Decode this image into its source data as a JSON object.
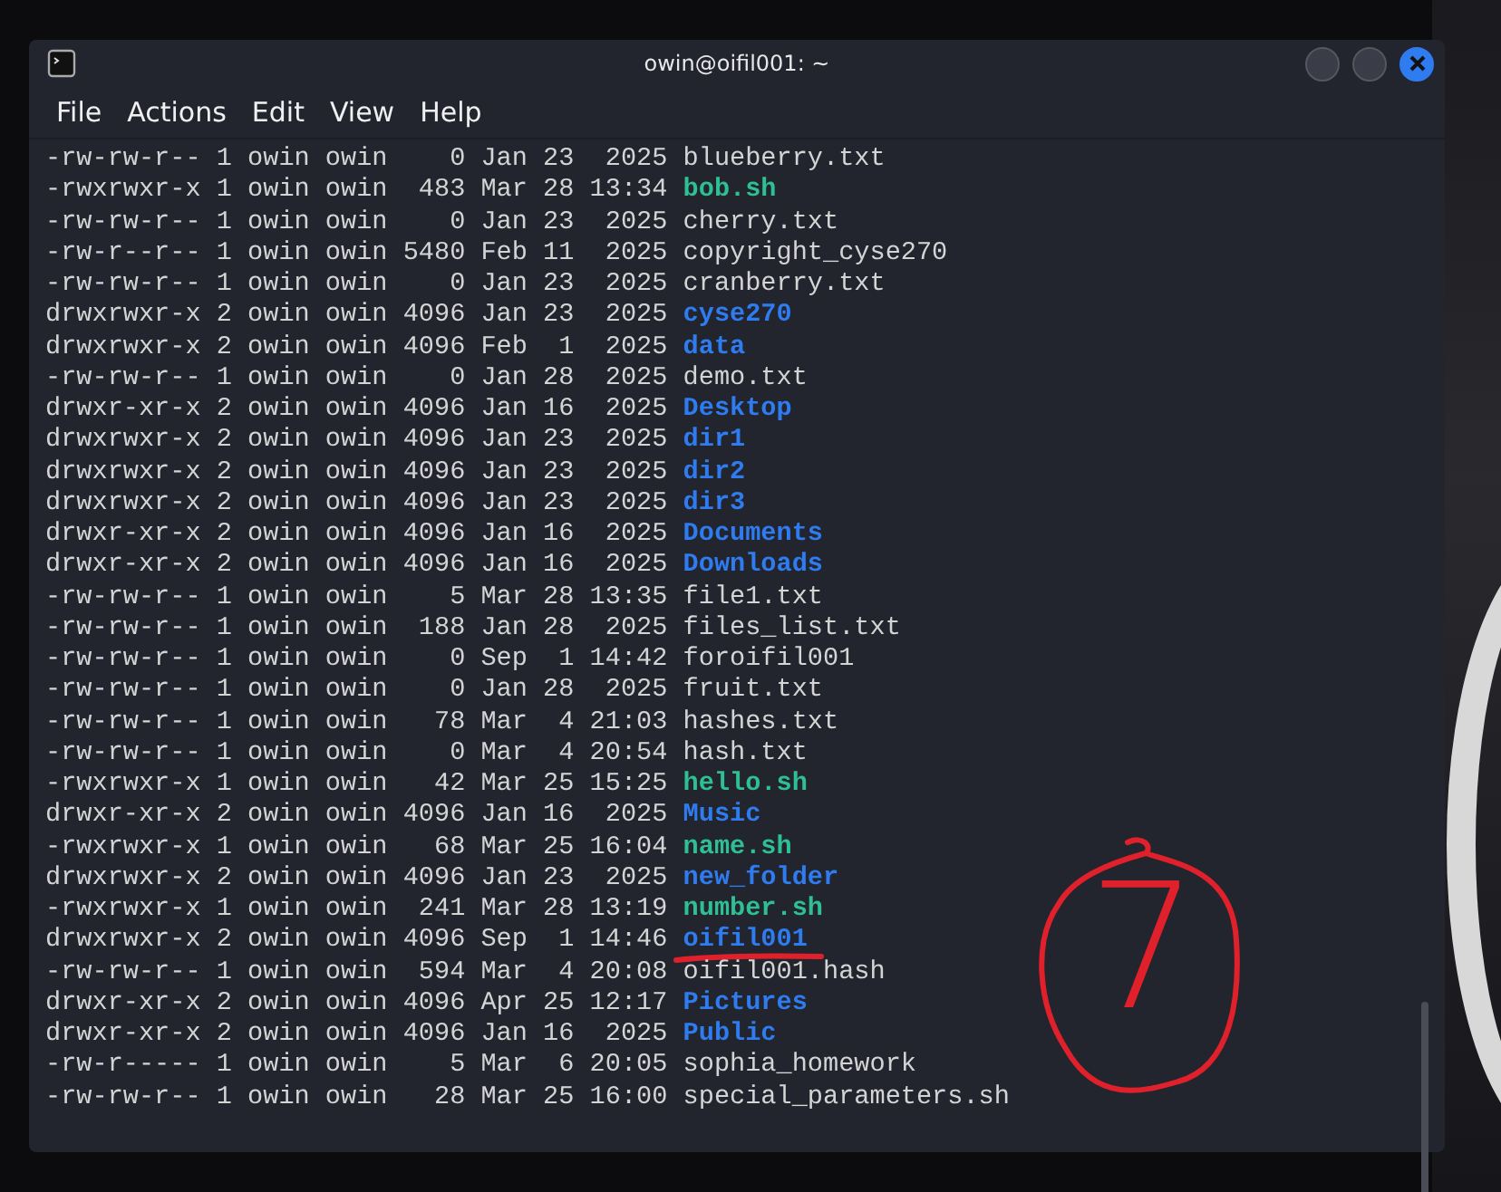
{
  "window": {
    "title": "owin@oifil001: ~"
  },
  "menu": [
    "File",
    "Actions",
    "Edit",
    "View",
    "Help"
  ],
  "listing": [
    {
      "meta": "-rw-rw-r-- 1 owin owin    0 Jan 23  2025",
      "name": "blueberry.txt",
      "kind": "file",
      "underlined": false
    },
    {
      "meta": "-rwxrwxr-x 1 owin owin  483 Mar 28 13:34",
      "name": "bob.sh",
      "kind": "exec",
      "underlined": false
    },
    {
      "meta": "-rw-rw-r-- 1 owin owin    0 Jan 23  2025",
      "name": "cherry.txt",
      "kind": "file",
      "underlined": false
    },
    {
      "meta": "-rw-r--r-- 1 owin owin 5480 Feb 11  2025",
      "name": "copyright_cyse270",
      "kind": "file",
      "underlined": false
    },
    {
      "meta": "-rw-rw-r-- 1 owin owin    0 Jan 23  2025",
      "name": "cranberry.txt",
      "kind": "file",
      "underlined": false
    },
    {
      "meta": "drwxrwxr-x 2 owin owin 4096 Jan 23  2025",
      "name": "cyse270",
      "kind": "dir",
      "underlined": false
    },
    {
      "meta": "drwxrwxr-x 2 owin owin 4096 Feb  1  2025",
      "name": "data",
      "kind": "dir",
      "underlined": false
    },
    {
      "meta": "-rw-rw-r-- 1 owin owin    0 Jan 28  2025",
      "name": "demo.txt",
      "kind": "file",
      "underlined": false
    },
    {
      "meta": "drwxr-xr-x 2 owin owin 4096 Jan 16  2025",
      "name": "Desktop",
      "kind": "dir",
      "underlined": false
    },
    {
      "meta": "drwxrwxr-x 2 owin owin 4096 Jan 23  2025",
      "name": "dir1",
      "kind": "dir",
      "underlined": false
    },
    {
      "meta": "drwxrwxr-x 2 owin owin 4096 Jan 23  2025",
      "name": "dir2",
      "kind": "dir",
      "underlined": false
    },
    {
      "meta": "drwxrwxr-x 2 owin owin 4096 Jan 23  2025",
      "name": "dir3",
      "kind": "dir",
      "underlined": false
    },
    {
      "meta": "drwxr-xr-x 2 owin owin 4096 Jan 16  2025",
      "name": "Documents",
      "kind": "dir",
      "underlined": false
    },
    {
      "meta": "drwxr-xr-x 2 owin owin 4096 Jan 16  2025",
      "name": "Downloads",
      "kind": "dir",
      "underlined": false
    },
    {
      "meta": "-rw-rw-r-- 1 owin owin    5 Mar 28 13:35",
      "name": "file1.txt",
      "kind": "file",
      "underlined": false
    },
    {
      "meta": "-rw-rw-r-- 1 owin owin  188 Jan 28  2025",
      "name": "files_list.txt",
      "kind": "file",
      "underlined": false
    },
    {
      "meta": "-rw-rw-r-- 1 owin owin    0 Sep  1 14:42",
      "name": "foroifil001",
      "kind": "file",
      "underlined": false
    },
    {
      "meta": "-rw-rw-r-- 1 owin owin    0 Jan 28  2025",
      "name": "fruit.txt",
      "kind": "file",
      "underlined": false
    },
    {
      "meta": "-rw-rw-r-- 1 owin owin   78 Mar  4 21:03",
      "name": "hashes.txt",
      "kind": "file",
      "underlined": false
    },
    {
      "meta": "-rw-rw-r-- 1 owin owin    0 Mar  4 20:54",
      "name": "hash.txt",
      "kind": "file",
      "underlined": false
    },
    {
      "meta": "-rwxrwxr-x 1 owin owin   42 Mar 25 15:25",
      "name": "hello.sh",
      "kind": "exec",
      "underlined": false
    },
    {
      "meta": "drwxr-xr-x 2 owin owin 4096 Jan 16  2025",
      "name": "Music",
      "kind": "dir",
      "underlined": false
    },
    {
      "meta": "-rwxrwxr-x 1 owin owin   68 Mar 25 16:04",
      "name": "name.sh",
      "kind": "exec",
      "underlined": false
    },
    {
      "meta": "drwxrwxr-x 2 owin owin 4096 Jan 23  2025",
      "name": "new_folder",
      "kind": "dir",
      "underlined": false
    },
    {
      "meta": "-rwxrwxr-x 1 owin owin  241 Mar 28 13:19",
      "name": "number.sh",
      "kind": "exec",
      "underlined": false
    },
    {
      "meta": "drwxrwxr-x 2 owin owin 4096 Sep  1 14:46",
      "name": "oifil001",
      "kind": "dir",
      "underlined": true
    },
    {
      "meta": "-rw-rw-r-- 1 owin owin  594 Mar  4 20:08",
      "name": "oifil001.hash",
      "kind": "file",
      "underlined": false
    },
    {
      "meta": "drwxr-xr-x 2 owin owin 4096 Apr 25 12:17",
      "name": "Pictures",
      "kind": "dir",
      "underlined": false
    },
    {
      "meta": "drwxr-xr-x 2 owin owin 4096 Jan 16  2025",
      "name": "Public",
      "kind": "dir",
      "underlined": false
    },
    {
      "meta": "-rw-r----- 1 owin owin    5 Mar  6 20:05",
      "name": "sophia_homework",
      "kind": "file",
      "underlined": false
    },
    {
      "meta": "-rw-rw-r-- 1 owin owin   28 Mar 25 16:00",
      "name": "special_parameters.sh",
      "kind": "file",
      "underlined": false
    }
  ],
  "annotation": {
    "text": "7"
  }
}
